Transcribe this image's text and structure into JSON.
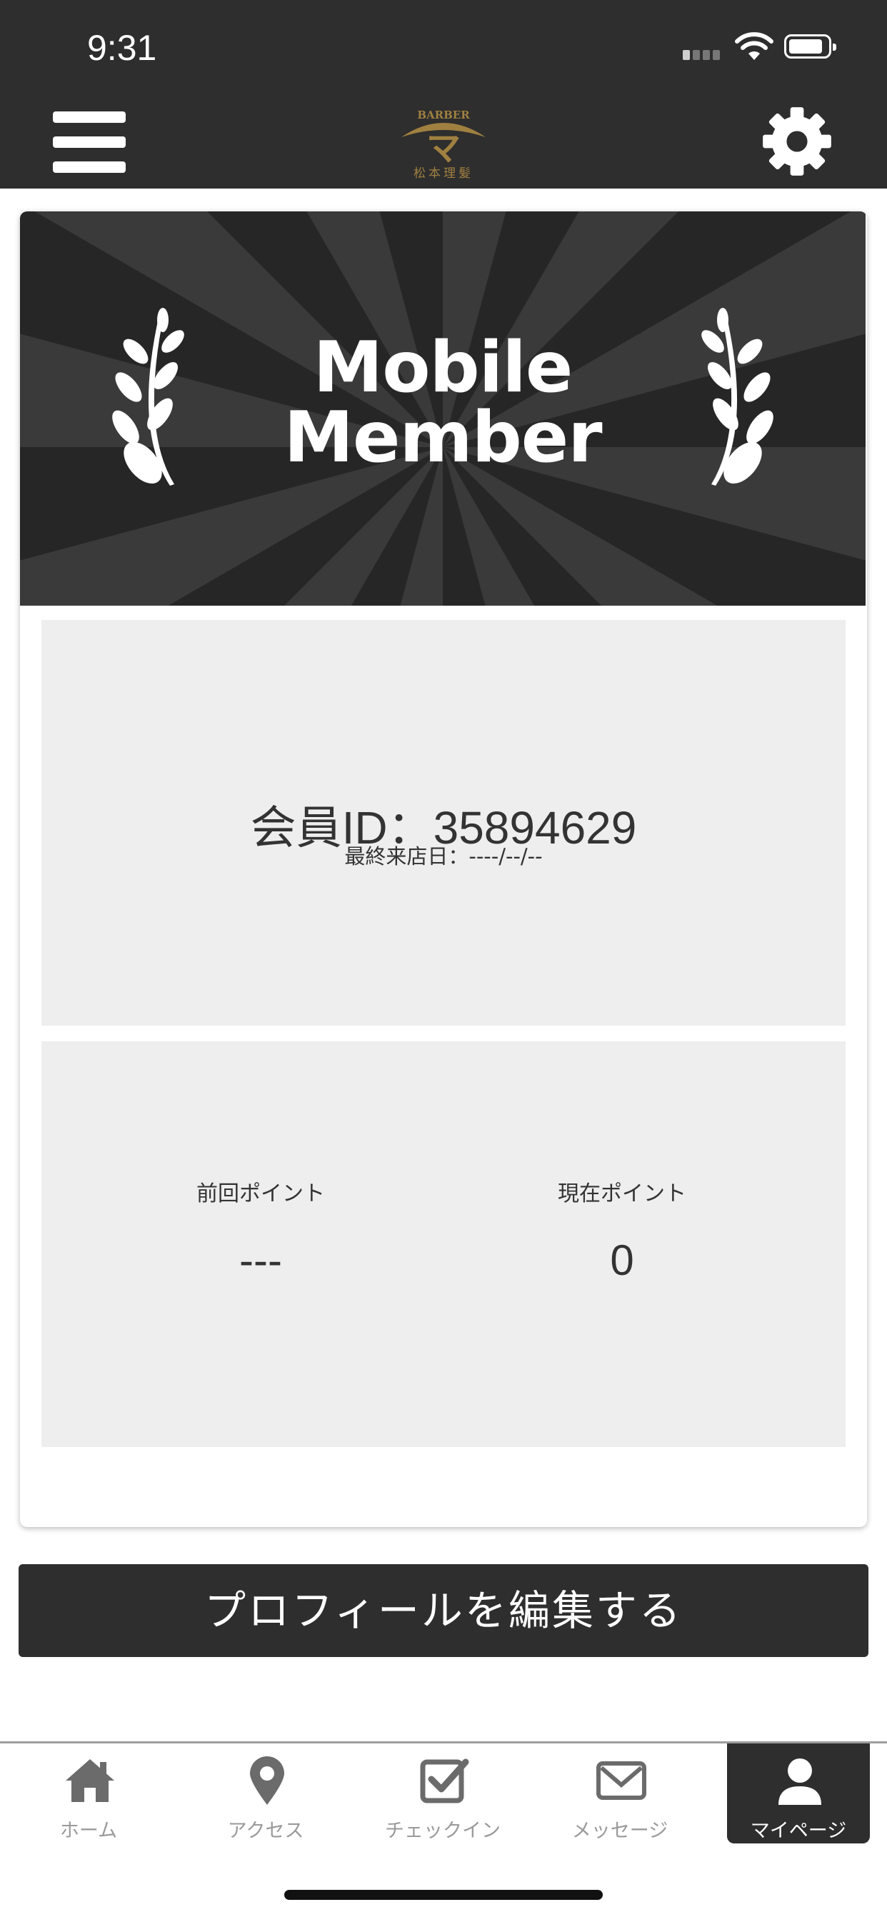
{
  "status_bar": {
    "time": "9:31"
  },
  "header": {
    "logo_text_top": "BARBER",
    "logo_mark": "マ",
    "logo_text_bottom": "松本理髪",
    "menu_icon": "hamburger-menu-icon",
    "settings_icon": "gear-icon"
  },
  "card": {
    "banner_line1": "Mobile",
    "banner_line2": "Member",
    "member_id": "会員ID：35894629",
    "last_visit": "最終来店日：----/--/--",
    "points": {
      "previous_label": "前回ポイント",
      "previous_value": "---",
      "current_label": "現在ポイント",
      "current_value": "0"
    }
  },
  "edit_profile_label": "プロフィールを編集する",
  "tabs": [
    {
      "label": "ホーム",
      "icon": "home-icon",
      "active": false
    },
    {
      "label": "アクセス",
      "icon": "map-pin-icon",
      "active": false
    },
    {
      "label": "チェックイン",
      "icon": "checkbox-icon",
      "active": false
    },
    {
      "label": "メッセージ",
      "icon": "envelope-icon",
      "active": false
    },
    {
      "label": "マイページ",
      "icon": "user-icon",
      "active": true
    }
  ],
  "colors": {
    "dark": "#2e2e2e",
    "panel": "#eeeeee",
    "logo_gold": "#a08040"
  }
}
